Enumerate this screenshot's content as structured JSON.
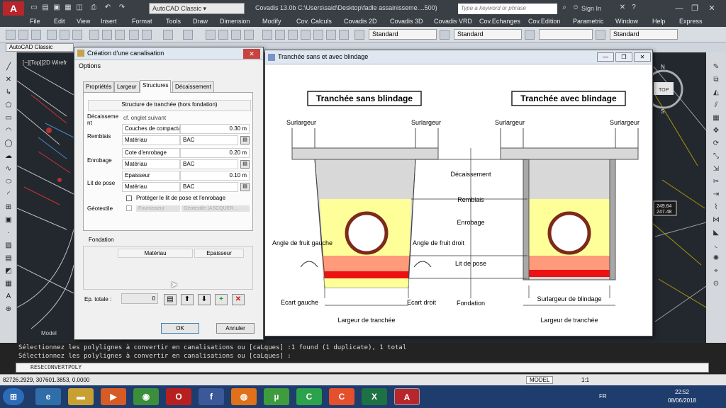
{
  "app": {
    "logo": "A",
    "workspace": "AutoCAD Classic",
    "title": "Covadis 13.0b   C:\\Users\\said\\Desktop\\fadle assainisseme....500)",
    "search_placeholder": "Type a keyword or phrase",
    "sign_in": "Sign In"
  },
  "menu": [
    "File",
    "Edit",
    "View",
    "Insert",
    "Format",
    "Tools",
    "Draw",
    "Dimension",
    "Modify",
    "Cov. Calculs",
    "Covadis 2D",
    "Covadis 3D",
    "Covadis VRD",
    "Cov.Echanges",
    "Cov.Edition",
    "Parametric",
    "Window",
    "Help",
    "Express"
  ],
  "toolbar": {
    "styles": [
      "Standard",
      "Standard",
      "Standard"
    ],
    "layer_combo": "AutoCAD Classic"
  },
  "viewport": {
    "label": "[−][Top][2D Wirefr",
    "model_tab": "Model",
    "nav": {
      "north": "N",
      "south": "S",
      "top": "TOP"
    },
    "dims": [
      "249.64",
      "247.48"
    ]
  },
  "dialog1": {
    "title": "Création d'une canalisation",
    "options": "Options",
    "tabs": [
      "Propriétés",
      "Largeur",
      "Structures",
      "Décaissement"
    ],
    "structure_header": "Structure de tranchée (hors fondation)",
    "rows": {
      "decaissement": {
        "label": "Décaisseme nt",
        "value": "cf. onglet suivant"
      },
      "remblais": {
        "label": "Remblais",
        "couches": "Couches de compactage",
        "couches_val": "0.30 m",
        "materiau": "Matériau",
        "materiau_val": "BAC"
      },
      "enrobage": {
        "label": "Enrobage",
        "cote": "Cote d'enrobage",
        "cote_val": "0.20 m",
        "materiau": "Matériau",
        "materiau_val": "BAC"
      },
      "litdepose": {
        "label": "Lit de pose",
        "epaisseur": "Epaisseur",
        "epaisseur_val": "0.10 m",
        "materiau": "Matériau",
        "materiau_val": "BAC"
      },
      "protect": "Protéger le lit de pose et l'enrobage",
      "geotextile": {
        "label": "Géotextile",
        "fournisseur": "Fournisseur",
        "value": "Géotextile (ASCQUER..."
      }
    },
    "fondation": "Fondation",
    "fond_cols": [
      "Matériau",
      "Epaisseur"
    ],
    "ep_totale": "Ep. totale :",
    "ep_value": "0",
    "ok": "OK",
    "cancel": "Annuler"
  },
  "dialog2": {
    "title": "Tranchée sans et avec blindage",
    "heading_left": "Tranchée sans blindage",
    "heading_right": "Tranchée avec blindage",
    "surlargeur": "Surlargeur",
    "layers": [
      "Décaissement",
      "Remblais",
      "Enrobage",
      "Lit de pose",
      "Fondation"
    ],
    "angle_gauche": "Angle de fruit gauche",
    "angle_droit": "Angle de fruit droit",
    "ecart_gauche": "Ecart gauche",
    "ecart_droit": "Ecart droit",
    "largeur": "Largeur de tranchée",
    "surlargeur_blindage": "Surlargeur de blindage",
    "colors": {
      "yellow": "#ffff99",
      "pink": "#ff9a7a",
      "red": "#ee1111",
      "gray": "#d8d8d8",
      "pipe": "#7b2a1c"
    }
  },
  "command": {
    "line1": "Sélectionnez les polylignes à convertir en canalisations ou [caLques] :1 found (1 duplicate), 1 total",
    "line2": "Sélectionnez les polylignes à convertir en canalisations ou [caLques] :",
    "input": "RESECONVERTPOLY"
  },
  "status": {
    "coords": "82726.2929, 307601.3853, 0.0000",
    "model": "MODEL",
    "scale": "1:1"
  },
  "taskbar": {
    "lang": "FR",
    "time": "22:52",
    "date": "08/06/2018"
  }
}
